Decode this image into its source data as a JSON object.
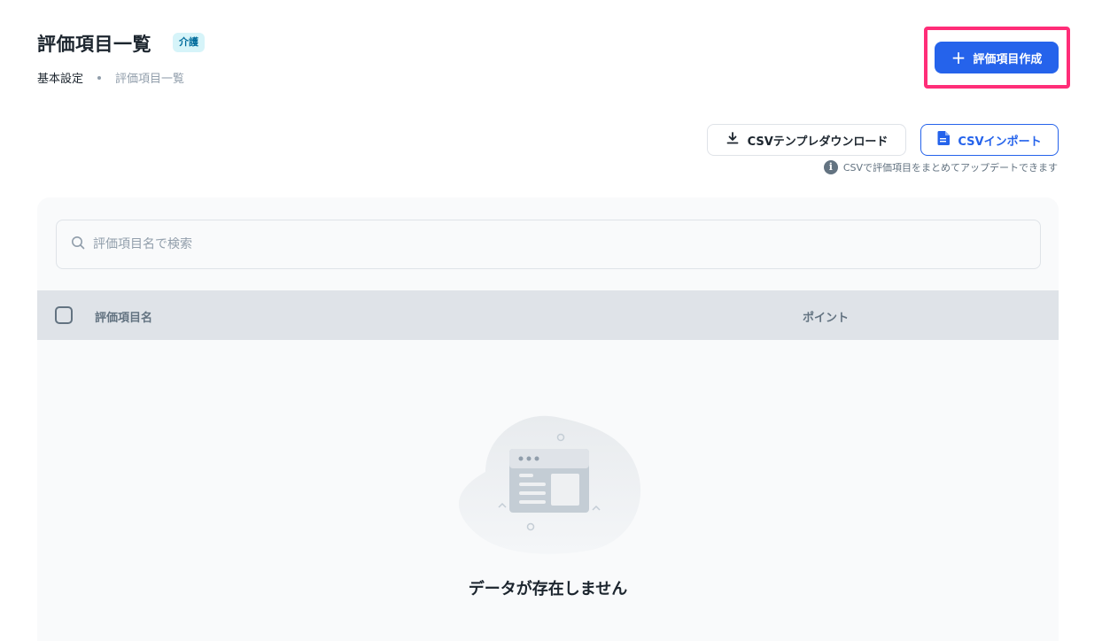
{
  "header": {
    "title": "評価項目一覧",
    "badge": "介護",
    "breadcrumb": [
      "基本設定",
      "評価項目一覧"
    ],
    "create_button": "評価項目作成"
  },
  "actions": {
    "download_button": "CSVテンプレダウンロード",
    "import_button": "CSVインポート",
    "help_text": "CSVで評価項目をまとめてアップデートできます"
  },
  "search": {
    "placeholder": "評価項目名で検索",
    "value": ""
  },
  "table": {
    "columns": [
      "評価項目名",
      "ポイント"
    ],
    "rows": []
  },
  "empty_state": {
    "message": "データが存在しません"
  },
  "colors": {
    "primary": "#2563eb",
    "highlight": "#ff2d78",
    "badge_bg": "#d6f4f9",
    "badge_text": "#006c9c",
    "table_header_bg": "#dfe3e8"
  }
}
